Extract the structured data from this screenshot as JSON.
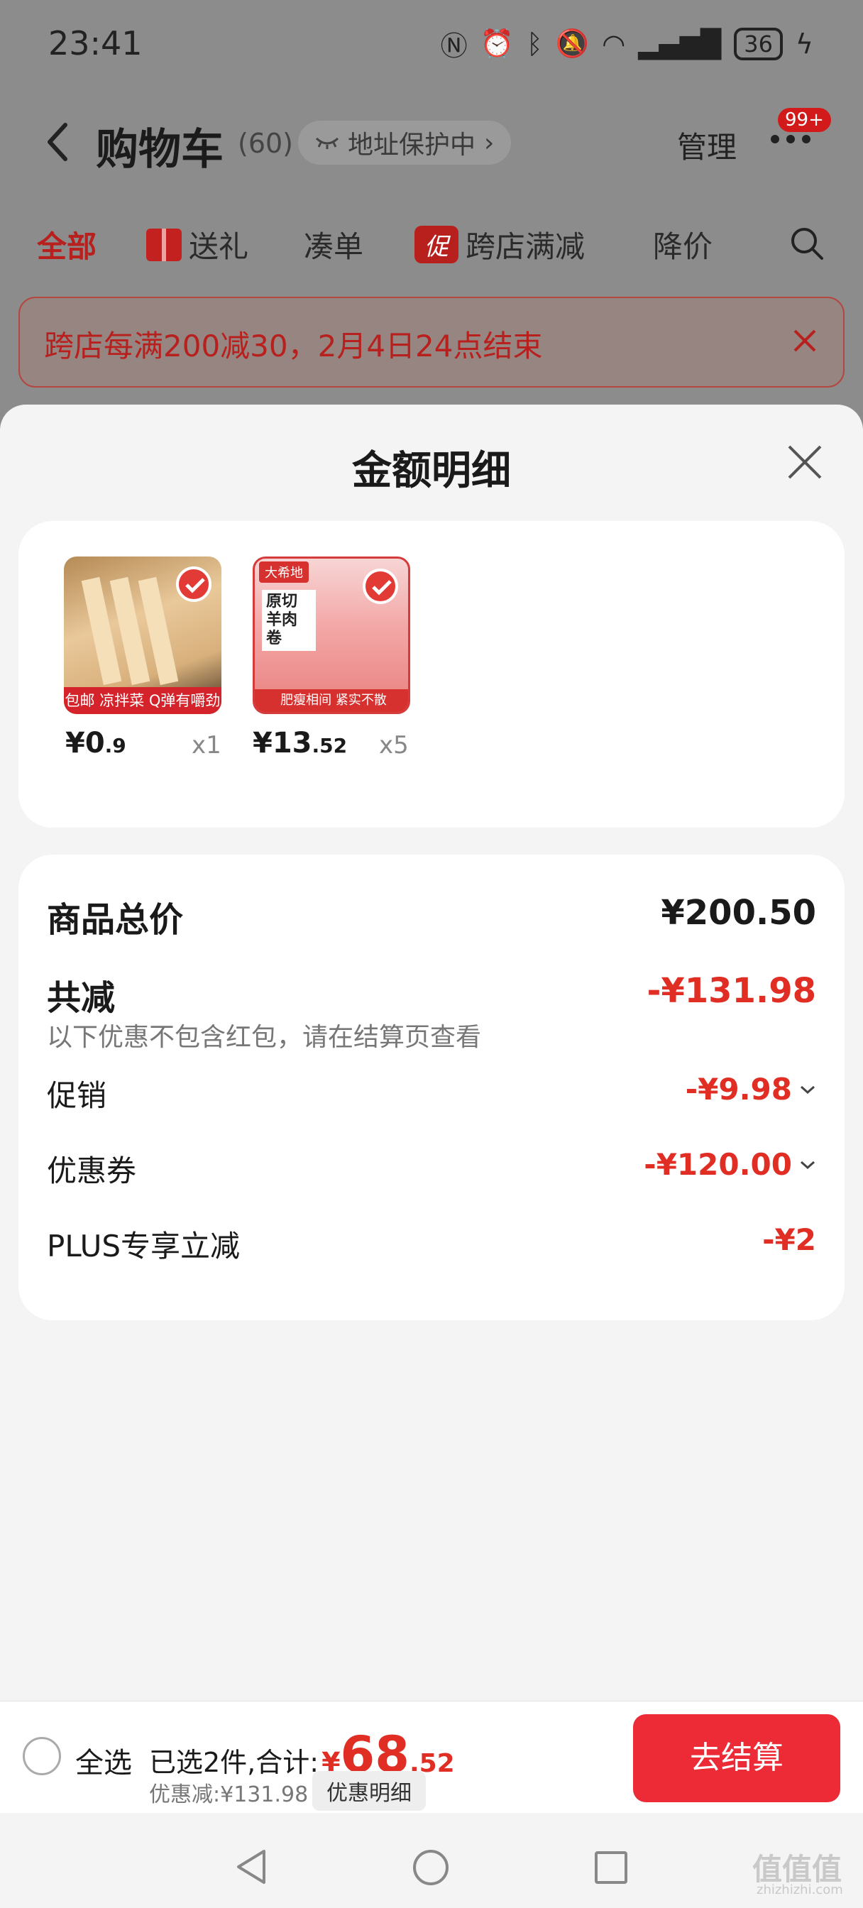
{
  "status": {
    "time": "23:41",
    "battery": "36",
    "icons": [
      "nfc-icon",
      "alarm-icon",
      "bluetooth-icon",
      "mute-icon",
      "wifi-icon",
      "signal-icon",
      "charging-icon"
    ]
  },
  "nav": {
    "title": "购物车",
    "count": "(60)",
    "address_protect": "地址保护中",
    "manage": "管理",
    "badge": "99+"
  },
  "filters": [
    {
      "label": "全部"
    },
    {
      "label": "送礼"
    },
    {
      "label": "凑单"
    },
    {
      "tag": "促",
      "label": "跨店满减"
    },
    {
      "label": "降价"
    }
  ],
  "notice": {
    "text": "跨店每满200减30，2月4日24点结束"
  },
  "sheet": {
    "title": "金额明细",
    "goods": [
      {
        "price_int": "¥0",
        "price_dec": ".9",
        "qty": "x1",
        "img_band": "包邮 凉拌菜 Q弹有嚼劲"
      },
      {
        "price_int": "¥13",
        "price_dec": ".52",
        "qty": "x5",
        "img_brand": "大希地",
        "img_name": "原切羊肉卷",
        "img_band": "肥瘦相间 紧实不散"
      }
    ],
    "summary": {
      "total_label": "商品总价",
      "total_value": "¥200.50",
      "reduce_label": "共减",
      "reduce_value": "-¥131.98",
      "reduce_note": "以下优惠不包含红包，请在结算页查看",
      "items": [
        {
          "label": "促销",
          "value": "-¥9.98"
        },
        {
          "label": "优惠券",
          "value": "-¥120.00"
        },
        {
          "label": "PLUS专享立减",
          "value": "-¥2"
        }
      ]
    }
  },
  "bottom": {
    "select_all": "全选",
    "selected_text": "已选2件,合计:",
    "yen": "¥",
    "total_int": "68",
    "total_dec": ".52",
    "discount_text": "优惠减:¥131.98",
    "detail_button": "优惠明细",
    "checkout": "去结算"
  },
  "watermark": {
    "text": "值值值",
    "sub": "zhizhizhi.com"
  },
  "colors": {
    "accent_red": "#e02e24",
    "checkout_red": "#ec2b36",
    "dim_overlay": "#8c8c8c"
  }
}
